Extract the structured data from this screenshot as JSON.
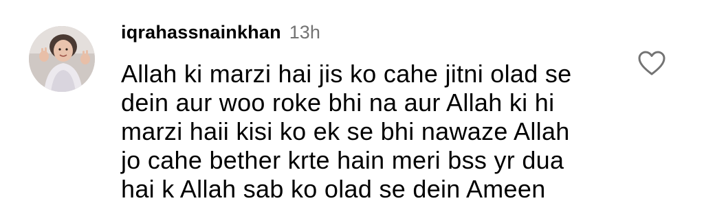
{
  "comment": {
    "username": "iqrahassnainkhan",
    "timestamp": "13h",
    "text": "Allah ki marzi hai jis ko cahe jitni olad se\ndein aur woo roke bhi na aur Allah ki hi\nmarzi haii kisi ko ek se bhi nawaze Allah\njo cahe bether krte hain meri bss yr dua\nhai k Allah sab ko olad se dein Ameen",
    "avatar_icon": "profile-photo",
    "like_icon": "heart-outline-icon"
  },
  "colors": {
    "text": "#000000",
    "muted": "#737373",
    "background": "#ffffff"
  }
}
